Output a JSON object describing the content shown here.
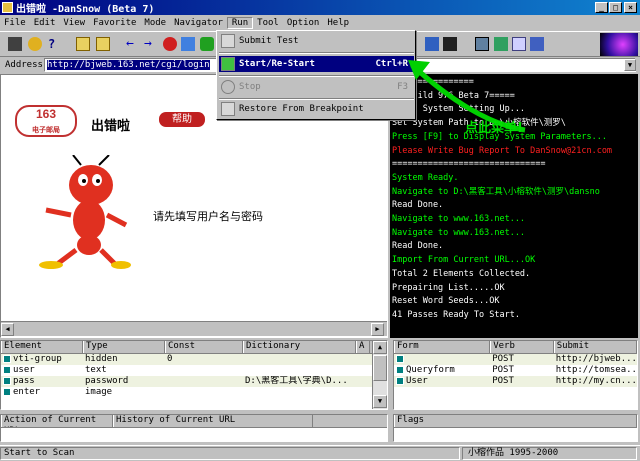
{
  "window": {
    "title": "出错啦 -DanSnow (Beta 7)",
    "min": "_",
    "max": "□",
    "close": "×"
  },
  "menubar": [
    "File",
    "Edit",
    "View",
    "Favorite",
    "Mode",
    "Navigator",
    "Run",
    "Tool",
    "Option",
    "Help"
  ],
  "address": {
    "label": "Address",
    "value": "http://bjweb.163.net/cgi/login"
  },
  "run_menu": [
    {
      "label": "Submit Test",
      "shortcut": ""
    },
    {
      "label": "Start/Re-Start",
      "shortcut": "Ctrl+R"
    },
    {
      "label": "Stop",
      "shortcut": "F3"
    },
    {
      "label": "Restore From Breakpoint",
      "shortcut": ""
    }
  ],
  "browser": {
    "logo": "163",
    "logo_sub": "电子邮局",
    "heading": "出错啦",
    "help_button": "帮助",
    "message": "请先填写用户名与密码"
  },
  "annotation": "点此菜单!",
  "console": [
    {
      "text": "         ================",
      "color": "white"
    },
    {
      "text": "         ow Build 976 Beta 7=====",
      "color": "white"
    },
    {
      "text": "Start System Setting Up...",
      "color": "white"
    },
    {
      "text": "Set System Path to D:\\小榕软件\\测罗\\",
      "color": "white"
    },
    {
      "text": "Press [F9] to Display System Parameters...",
      "color": "green"
    },
    {
      "text": "Please Write Bug Report To DanSnow@21cn.com",
      "color": "red"
    },
    {
      "text": "==============================",
      "color": "white"
    },
    {
      "text": "System Ready.",
      "color": "green"
    },
    {
      "text": "Navigate to D:\\黑客工具\\小榕软件\\测罗\\dansno",
      "color": "green"
    },
    {
      "text": "Read Done.",
      "color": "white"
    },
    {
      "text": "Navigate to www.163.net...",
      "color": "green"
    },
    {
      "text": "Navigate to www.163.net...",
      "color": "green"
    },
    {
      "text": "Read Done.",
      "color": "white"
    },
    {
      "text": "Import From Current URL...OK",
      "color": "green"
    },
    {
      "text": "Total 2 Elements Collected.",
      "color": "white"
    },
    {
      "text": "Prepairing List.....OK",
      "color": "white"
    },
    {
      "text": "Reset Word Seeds...OK",
      "color": "white"
    },
    {
      "text": "41 Passes Ready To Start.",
      "color": "white"
    }
  ],
  "elements_table": {
    "headers": [
      "Element",
      "Type",
      "Const",
      "Dictionary",
      "A"
    ],
    "rows": [
      {
        "element": "vti-group",
        "type": "hidden",
        "const": "0",
        "dictionary": ""
      },
      {
        "element": "user",
        "type": "text",
        "const": "",
        "dictionary": ""
      },
      {
        "element": "pass",
        "type": "password",
        "const": "",
        "dictionary": "D:\\黑客工具\\字典\\D..."
      },
      {
        "element": "enter",
        "type": "image",
        "const": "",
        "dictionary": ""
      }
    ]
  },
  "forms_table": {
    "headers": [
      "Form",
      "Verb",
      "Submit"
    ],
    "rows": [
      {
        "form": "",
        "verb": "POST",
        "submit": "http://bjweb..."
      },
      {
        "form": "Queryform",
        "verb": "POST",
        "submit": "http://tomsea..."
      },
      {
        "form": "User",
        "verb": "POST",
        "submit": "http://my.cn..."
      }
    ]
  },
  "tabs": {
    "action": "Action of Current URL",
    "history": "History of Current URL",
    "flags": "Flags"
  },
  "status": {
    "left": "Start to Scan",
    "right": "小榕作品 1995-2000"
  }
}
